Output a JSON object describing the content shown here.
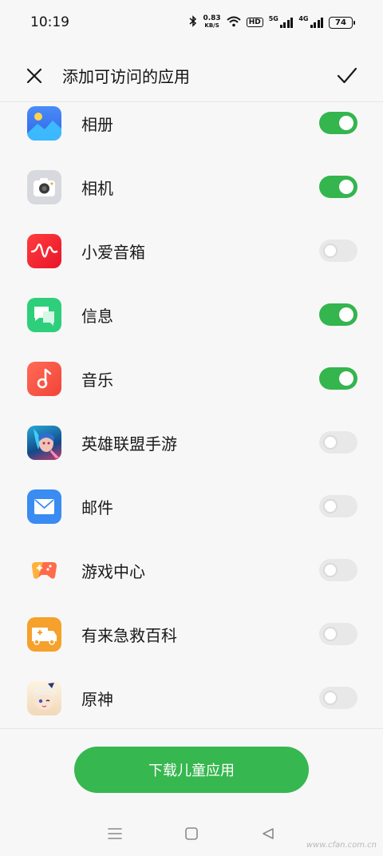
{
  "status": {
    "time": "10:19",
    "speed_value": "0.83",
    "speed_unit": "KB/S",
    "hd": "HD",
    "net_a": "5G",
    "net_b": "4G",
    "battery": "74"
  },
  "header": {
    "title": "添加可访问的应用"
  },
  "apps": [
    {
      "label": "相册",
      "enabled": true,
      "icon": "gallery-icon"
    },
    {
      "label": "相机",
      "enabled": true,
      "icon": "camera-icon"
    },
    {
      "label": "小爱音箱",
      "enabled": false,
      "icon": "xiaoai-speaker-icon"
    },
    {
      "label": "信息",
      "enabled": true,
      "icon": "messages-icon"
    },
    {
      "label": "音乐",
      "enabled": true,
      "icon": "music-icon"
    },
    {
      "label": "英雄联盟手游",
      "enabled": false,
      "icon": "lol-game-icon"
    },
    {
      "label": "邮件",
      "enabled": false,
      "icon": "mail-icon"
    },
    {
      "label": "游戏中心",
      "enabled": false,
      "icon": "game-center-icon"
    },
    {
      "label": "有来急救百科",
      "enabled": false,
      "icon": "ambulance-icon"
    },
    {
      "label": "原神",
      "enabled": false,
      "icon": "genshin-icon"
    }
  ],
  "footer": {
    "download_label": "下载儿童应用",
    "watermark": "www.cfan.com.cn"
  },
  "colors": {
    "toggle_on": "#34b54e",
    "toggle_off": "#e8e8e8",
    "primary_button": "#37b74f"
  }
}
